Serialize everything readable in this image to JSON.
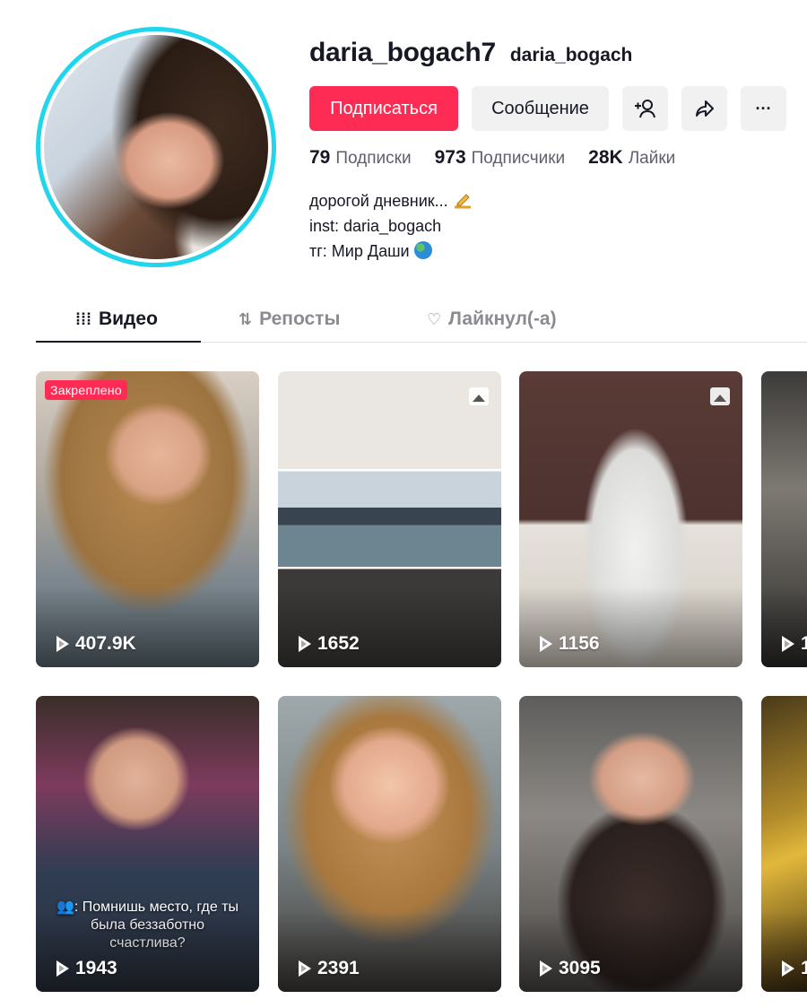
{
  "profile": {
    "username": "daria_bogach7",
    "nickname": "daria_bogach",
    "follow_label": "Подписаться",
    "message_label": "Сообщение",
    "more_label": "···"
  },
  "stats": {
    "following_count": "79",
    "following_label": "Подписки",
    "followers_count": "973",
    "followers_label": "Подписчики",
    "likes_count": "28K",
    "likes_label": "Лайки"
  },
  "bio": {
    "line1": "дорогой дневник...",
    "line2": "inst: daria_bogach",
    "line3": "тг: Мир Даши"
  },
  "tabs": [
    {
      "label": "Видео",
      "icon": "grid-icon"
    },
    {
      "label": "Репосты",
      "icon": "repost-icon"
    },
    {
      "label": "Лайкнул(-а)",
      "icon": "liked-heart-icon"
    }
  ],
  "videos": [
    {
      "views": "407.9K",
      "badge": "Закреплено"
    },
    {
      "views": "1652",
      "photo": true
    },
    {
      "views": "1156",
      "photo": true
    },
    {
      "views": "1"
    },
    {
      "views": "1943",
      "caption": "👥: Помнишь место, где ты была беззаботно счастлива?"
    },
    {
      "views": "2391"
    },
    {
      "views": "3095"
    },
    {
      "views": "1"
    }
  ],
  "colors": {
    "accent": "#fe2c55",
    "avatar_ring": "#20d5ec",
    "secondary_bg": "#f1f1f2"
  }
}
